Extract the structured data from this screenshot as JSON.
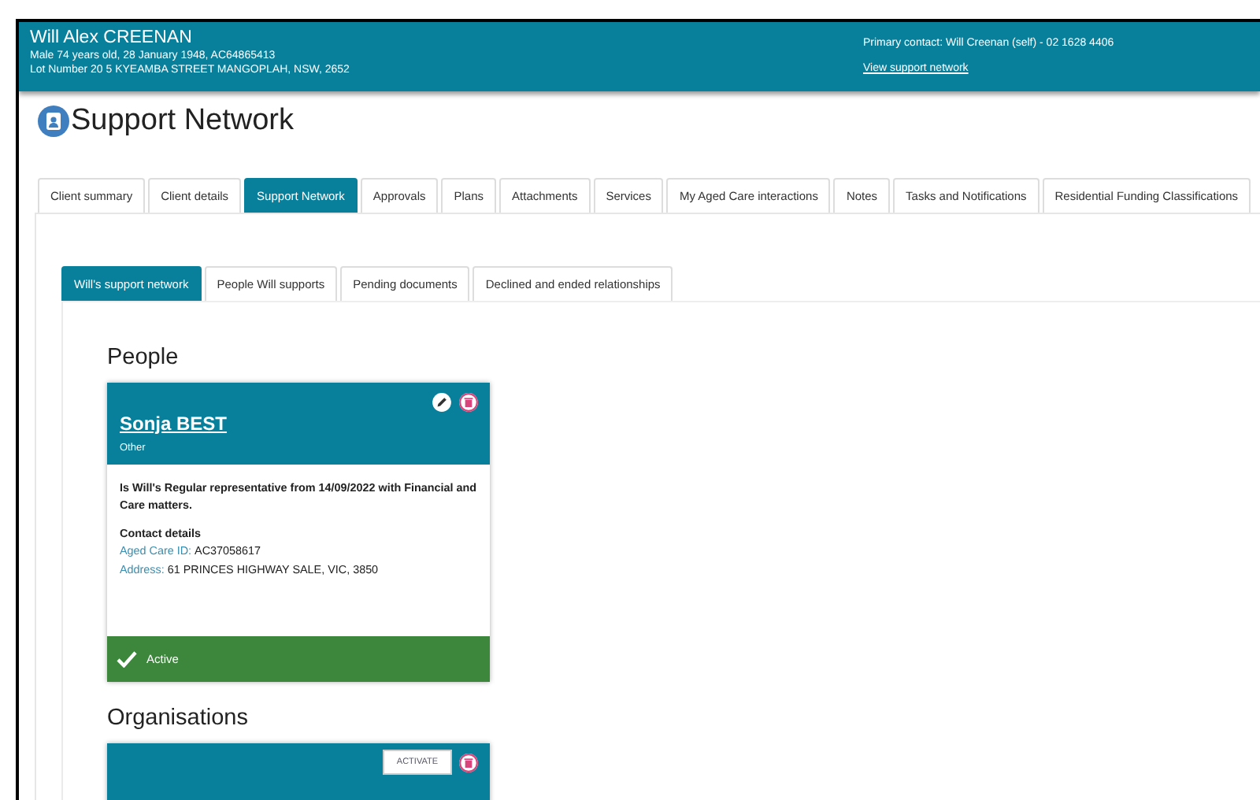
{
  "client": {
    "name": "Will Alex CREENAN",
    "details": "Male 74 years old, 28 January 1948, AC64865413",
    "address": "Lot Number 20 5 KYEAMBA STREET MANGOPLAH, NSW, 2652",
    "primary_contact": "Primary contact: Will Creenan (self) - 02 1628 4406",
    "support_link": "View support network"
  },
  "page_title": "Support Network",
  "tabs": [
    {
      "label": "Client summary",
      "selected": false
    },
    {
      "label": "Client details",
      "selected": false
    },
    {
      "label": "Support Network",
      "selected": true
    },
    {
      "label": "Approvals",
      "selected": false
    },
    {
      "label": "Plans",
      "selected": false
    },
    {
      "label": "Attachments",
      "selected": false
    },
    {
      "label": "Services",
      "selected": false
    },
    {
      "label": "My Aged Care interactions",
      "selected": false
    },
    {
      "label": "Notes",
      "selected": false
    },
    {
      "label": "Tasks and Notifications",
      "selected": false
    },
    {
      "label": "Residential Funding Classifications",
      "selected": false
    }
  ],
  "subtabs": [
    {
      "label": "Will's support network",
      "selected": true
    },
    {
      "label": "People Will supports",
      "selected": false
    },
    {
      "label": "Pending documents",
      "selected": false
    },
    {
      "label": "Declined and ended relationships",
      "selected": false
    }
  ],
  "sections": [
    {
      "heading": "People",
      "cards": [
        {
          "kind": "person",
          "name": "Sonja BEST",
          "role": "Other",
          "description": "Is Will's Regular representative from 14/09/2022 with Financial and Care matters.",
          "contact_heading": "Contact details",
          "fields": [
            {
              "label": "Aged Care ID:",
              "value": "AC37058617"
            },
            {
              "label": "Address:",
              "value": "61 PRINCES HIGHWAY SALE, VIC, 3850"
            }
          ],
          "status": "Active"
        }
      ]
    },
    {
      "heading": "Organisations",
      "cards": [
        {
          "kind": "organisation",
          "action": "ACTIVATE"
        }
      ]
    }
  ]
}
